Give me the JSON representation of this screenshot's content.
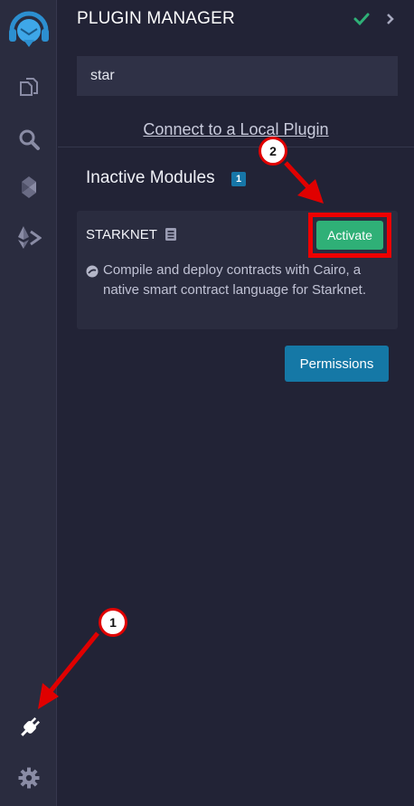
{
  "panel": {
    "title": "PLUGIN MANAGER",
    "search_value": "star",
    "connect_link": "Connect to a Local Plugin",
    "section_title": "Inactive Modules",
    "section_count": "1"
  },
  "plugin": {
    "name": "STARKNET",
    "activate_label": "Activate",
    "description": "Compile and deploy contracts with Cairo, a native smart contract language for Starknet."
  },
  "permissions_label": "Permissions",
  "annotations": {
    "callout_1": "1",
    "callout_2": "2",
    "highlight_color": "#ee0000"
  },
  "colors": {
    "activate": "#2fb077",
    "permissions": "#1578a6",
    "success_check": "#2fb077"
  },
  "icons": [
    "remix-logo-icon",
    "file-explorer-icon",
    "search-icon",
    "solidity-compiler-icon",
    "deploy-run-icon",
    "plugin-manager-icon",
    "settings-gear-icon",
    "checkmark-icon",
    "chevron-right-icon",
    "book-icon",
    "plugin-logo-icon"
  ]
}
